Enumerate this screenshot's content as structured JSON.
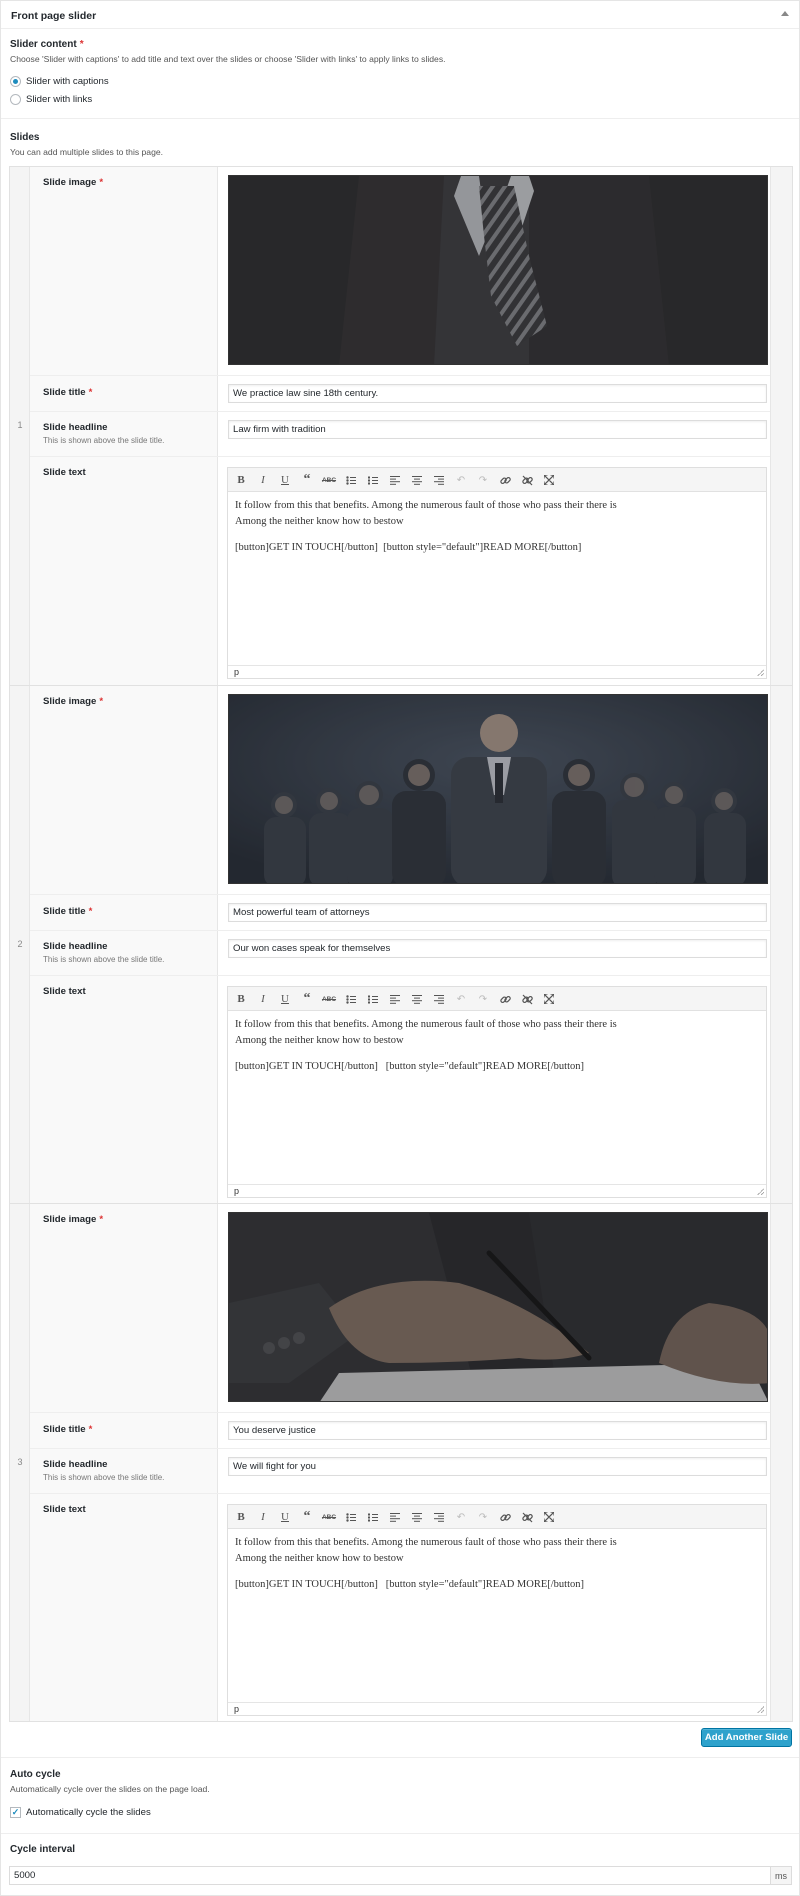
{
  "panel": {
    "title": "Front page slider"
  },
  "slider_content": {
    "label": "Slider content",
    "required_mark": "*",
    "description": "Choose 'Slider with captions' to add title and text over the slides or choose 'Slider with links' to apply links to slides.",
    "options": [
      {
        "label": "Slider with captions",
        "selected": true
      },
      {
        "label": "Slider with links",
        "selected": false
      }
    ]
  },
  "slides": {
    "label": "Slides",
    "description": "You can add multiple slides to this page.",
    "image_label": "Slide image",
    "title_label": "Slide title",
    "headline_label": "Slide headline",
    "headline_desc": "This is shown above the slide title.",
    "text_label": "Slide text",
    "required_mark": "*",
    "editor_path": "p",
    "items": [
      {
        "number": "1",
        "image": "dark-tie-suit",
        "title": "We practice law sine 18th century.",
        "headline": "Law firm with tradition",
        "text_line1": "It follow from this that benefits. Among the numerous fault of those who pass their there is",
        "text_line2": "Among the neither know how to bestow",
        "text_line3": "[button]GET IN TOUCH[/button]  [button style=\"default\"]READ MORE[/button]"
      },
      {
        "number": "2",
        "image": "team-of-attorneys",
        "title": "Most powerful team of attorneys",
        "headline": "Our won cases speak for themselves",
        "text_line1": "It follow from this that benefits. Among the numerous fault of those who pass their there is",
        "text_line2": "Among the neither know how to bestow",
        "text_line3": "[button]GET IN TOUCH[/button]   [button style=\"default\"]READ MORE[/button]"
      },
      {
        "number": "3",
        "image": "hand-signing",
        "title": "You deserve justice",
        "headline": "We will fight for you",
        "text_line1": "It follow from this that benefits. Among the numerous fault of those who pass their there is",
        "text_line2": "Among the neither know how to bestow",
        "text_line3": "[button]GET IN TOUCH[/button]   [button style=\"default\"]READ MORE[/button]"
      }
    ],
    "add_button": "Add Another Slide"
  },
  "auto_cycle": {
    "label": "Auto cycle",
    "description": "Automatically cycle over the slides on the page load.",
    "checkbox_label": "Automatically cycle the slides",
    "checked": true
  },
  "cycle_interval": {
    "label": "Cycle interval",
    "value": "5000",
    "unit": "ms"
  },
  "colors": {
    "accent": "#2ea2cc",
    "required": "#dc3232"
  }
}
